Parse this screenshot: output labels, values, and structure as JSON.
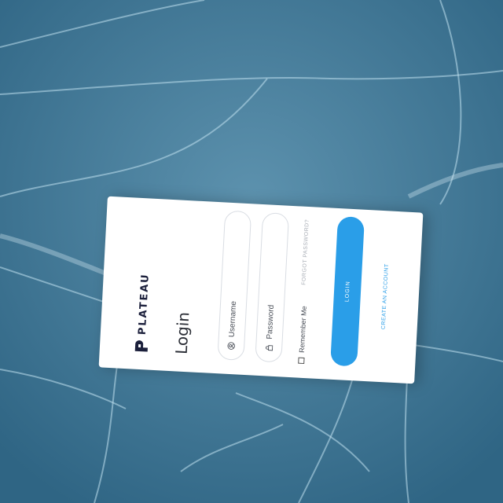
{
  "brand": {
    "name": "PLATEAU"
  },
  "login": {
    "title": "Login",
    "username_placeholder": "Username",
    "password_placeholder": "Password",
    "remember_label": "Remember Me",
    "forgot_label": "FORGOT PASSWORD?",
    "login_button": "LOGIN",
    "create_account": "CREATE AN ACCOUNT"
  },
  "colors": {
    "background": "#3c7494",
    "accent": "#2a9ee8",
    "card": "#ffffff",
    "logo": "#1b1f3b"
  },
  "icons": {
    "username": "user-circle-icon",
    "password": "lock-icon"
  }
}
